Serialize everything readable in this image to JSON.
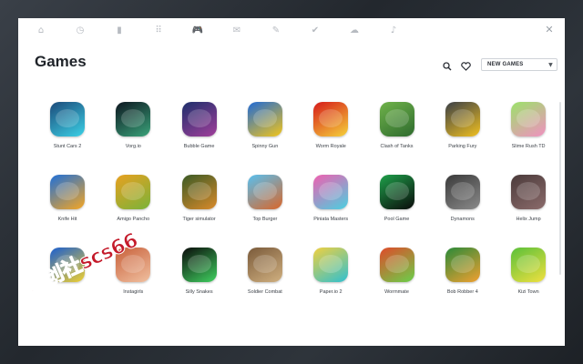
{
  "nav": {
    "tabs": [
      {
        "name": "tab-home",
        "icon": "home-icon",
        "glyph": "⌂",
        "active": false
      },
      {
        "name": "tab-history",
        "icon": "clock-icon",
        "glyph": "◷",
        "active": false
      },
      {
        "name": "tab-bookmarks",
        "icon": "bookmark-icon",
        "glyph": "▮",
        "active": false
      },
      {
        "name": "tab-apps",
        "icon": "grid-icon",
        "glyph": "⠿",
        "active": false
      },
      {
        "name": "tab-games",
        "icon": "gamepad-icon",
        "glyph": "🎮",
        "active": true
      },
      {
        "name": "tab-mail",
        "icon": "envelope-icon",
        "glyph": "✉",
        "active": false
      },
      {
        "name": "tab-notes",
        "icon": "pencil-icon",
        "glyph": "✎",
        "active": false
      },
      {
        "name": "tab-tasks",
        "icon": "check-icon",
        "glyph": "✔",
        "active": false
      },
      {
        "name": "tab-weather",
        "icon": "cloud-icon",
        "glyph": "☁",
        "active": false
      },
      {
        "name": "tab-music",
        "icon": "music-note-icon",
        "glyph": "♪",
        "active": false
      }
    ],
    "close_glyph": "✕"
  },
  "header": {
    "title": "Games",
    "filter": {
      "selected": "NEW GAMES"
    }
  },
  "games": [
    {
      "label": "Stunt Cars 2",
      "colors": [
        "#1c4a7a",
        "#3bd1e6"
      ]
    },
    {
      "label": "Vorg.io",
      "colors": [
        "#0d1620",
        "#3aa37a"
      ]
    },
    {
      "label": "Bubble Game",
      "colors": [
        "#1d2f6b",
        "#a13f9a"
      ]
    },
    {
      "label": "Spinny Gun",
      "colors": [
        "#1f6ad6",
        "#f2c51b"
      ]
    },
    {
      "label": "Worm Royale",
      "colors": [
        "#d61a1a",
        "#f5d23a"
      ]
    },
    {
      "label": "Clash of Tanks",
      "colors": [
        "#6fb24a",
        "#2e6b2e"
      ]
    },
    {
      "label": "Parking Fury",
      "colors": [
        "#3a3f47",
        "#f0c020"
      ]
    },
    {
      "label": "Slime Rush TD",
      "colors": [
        "#9be26a",
        "#f090c0"
      ]
    },
    {
      "label": "Knife Hit",
      "colors": [
        "#1e6fd9",
        "#f5a623"
      ]
    },
    {
      "label": "Amigo Pancho",
      "colors": [
        "#e8a020",
        "#7ab33a"
      ]
    },
    {
      "label": "Tiger simulator",
      "colors": [
        "#3a5a26",
        "#d98a2a"
      ]
    },
    {
      "label": "Top Burger",
      "colors": [
        "#58c0f0",
        "#d9662a"
      ]
    },
    {
      "label": "Piniata Masters",
      "colors": [
        "#f060b0",
        "#4ad0e0"
      ]
    },
    {
      "label": "Pool Game",
      "colors": [
        "#1ea04a",
        "#0b0b0b"
      ]
    },
    {
      "label": "Dynamons",
      "colors": [
        "#3a3a3a",
        "#8a8a8a"
      ]
    },
    {
      "label": "Helix Jump",
      "colors": [
        "#4a3a3a",
        "#8b6b6b"
      ]
    },
    {
      "label": "",
      "colors": [
        "#1a5ed0",
        "#f0d030"
      ]
    },
    {
      "label": "Instagirls",
      "colors": [
        "#c8603a",
        "#f0c0a0"
      ]
    },
    {
      "label": "Silly Snakes",
      "colors": [
        "#0a0a0a",
        "#40d060"
      ]
    },
    {
      "label": "Soldier Combat",
      "colors": [
        "#7a5a3a",
        "#d0b080"
      ]
    },
    {
      "label": "Paper.io 2",
      "colors": [
        "#f0d040",
        "#30c0d0"
      ]
    },
    {
      "label": "Wormmate",
      "colors": [
        "#e04a2a",
        "#6ad04a"
      ]
    },
    {
      "label": "Bob Robber 4",
      "colors": [
        "#2a8a3a",
        "#f0a030"
      ]
    },
    {
      "label": "Kizi Town",
      "colors": [
        "#5ac03a",
        "#f0e040"
      ]
    }
  ],
  "watermark": {
    "text": "数创社scs66"
  }
}
